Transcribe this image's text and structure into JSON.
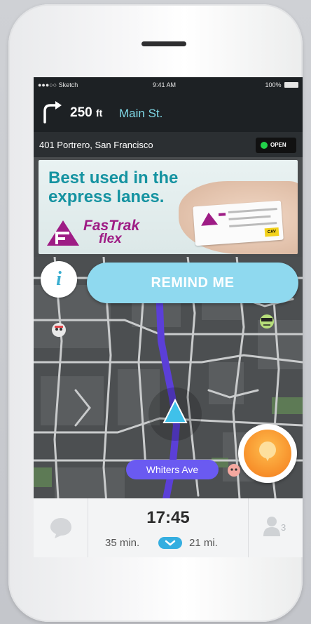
{
  "status_bar": {
    "carrier": "●●●○○ Sketch",
    "time": "9:41 AM",
    "battery": "100%"
  },
  "instruction": {
    "distance": "250",
    "unit": "ft",
    "street": "Main St."
  },
  "destination": {
    "address": "401 Portrero, San Francisco",
    "badge": "OPEN"
  },
  "ad": {
    "headline": "Best used in the express lanes.",
    "brand_line1": "FasTrak",
    "brand_line2": "flex",
    "card_tag": "CAV"
  },
  "map": {
    "remind_label": "REMIND ME",
    "info_label": "i",
    "street_label": "Whiters Ave"
  },
  "trip": {
    "eta": "17:45",
    "duration": "35 min.",
    "distance": "21 mi.",
    "users_count": "3"
  },
  "colors": {
    "accent": "#35aee0",
    "route": "#5b3fd8",
    "report": "#f78f2a",
    "brand": "#9e1c85"
  },
  "icons": {
    "turn": "turn-right-icon",
    "info": "info-icon",
    "report": "report-icon",
    "chat": "chat-bubble-icon",
    "users": "users-icon",
    "chevron": "chevron-down-icon"
  }
}
